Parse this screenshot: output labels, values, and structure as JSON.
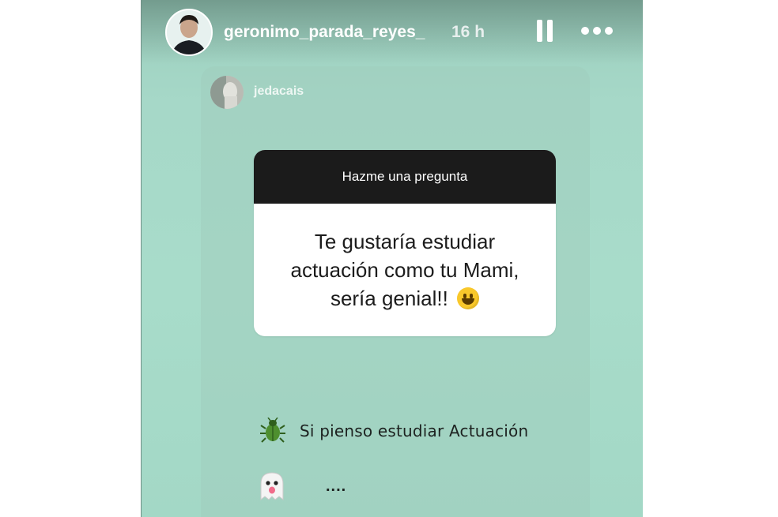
{
  "story": {
    "username": "geronimo_parada_reyes_",
    "time": "16 h",
    "controls": {
      "pause_icon": "pause-icon",
      "more_icon": "more-options-icon"
    }
  },
  "reply": {
    "username": "jedacais"
  },
  "question_sticker": {
    "header": "Hazme una pregunta",
    "question": "Te gustaría estudiar actuación como tu Mami, sería genial!!",
    "emoji": "grinning-face-emoji"
  },
  "answers": [
    {
      "icon": "beetle-emoji",
      "text": "Si pienso estudiar Actuación"
    },
    {
      "icon": "ghost-emoji",
      "text": "...."
    }
  ],
  "colors": {
    "story_background": "#a8dcca",
    "sticker_header": "#1b1b1b",
    "sticker_body": "#ffffff"
  }
}
